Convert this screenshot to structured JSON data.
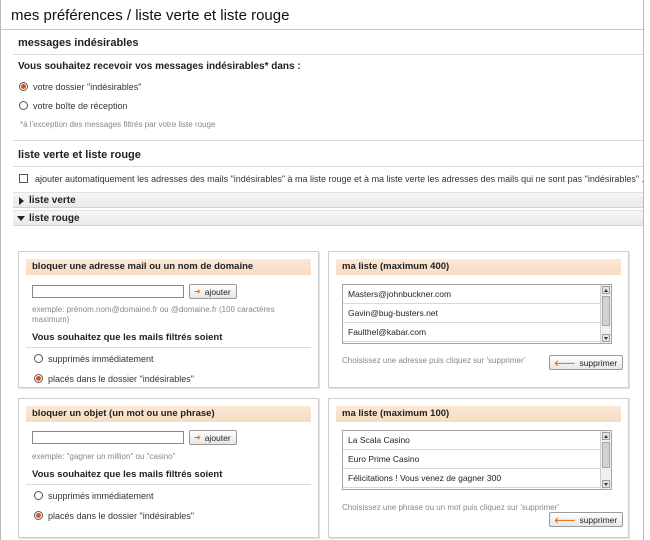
{
  "page": {
    "title": "mes préférences / liste verte et liste rouge"
  },
  "spam": {
    "heading": "messages indésirables",
    "question": "Vous souhaitez recevoir vos messages indésirables* dans :",
    "options": [
      "votre dossier \"indésirables\"",
      "votre boîte de réception"
    ],
    "selected": 0,
    "footnote": "*à l'exception des messages filtrés par votre liste rouge"
  },
  "lists": {
    "heading": "liste verte et liste rouge",
    "auto_add_label": "ajouter automatiquement les adresses des mails \"indésirables\" à ma liste rouge et à ma liste verte les adresses des mails qui ne sont pas \"indésirables\" .",
    "auto_add_checked": false,
    "green_label": "liste verte",
    "red_label": "liste rouge"
  },
  "block_address": {
    "title": "bloquer une adresse mail ou un nom de domaine",
    "input_value": "",
    "button": "ajouter",
    "example": "exemple: prénom.nom@domaine.fr ou @domaine.fr (100 caractères maximum)",
    "filter_question": "Vous souhaitez que les mails filtrés soient",
    "options": [
      "supprimés immédiatement",
      "placés dans le dossier \"indésirables\""
    ],
    "selected": 1
  },
  "address_list": {
    "title": "ma liste (maximum 400)",
    "items": [
      "Masters@johnbuckner.com",
      "Gavin@bug-busters.net",
      "Faulthel@kabar.com"
    ],
    "hint": "Choisissez une adresse puis cliquez sur 'supprimer'",
    "button": "supprimer"
  },
  "block_phrase": {
    "title": "bloquer un objet (un mot ou une phrase)",
    "input_value": "",
    "button": "ajouter",
    "example": "exemple: \"gagner un million\" ou \"casino\"",
    "filter_question": "Vous souhaitez que les mails filtrés soient",
    "options": [
      "supprimés immédiatement",
      "placés dans le dossier \"indésirables\""
    ],
    "selected": 1
  },
  "phrase_list": {
    "title": "ma liste (maximum 100)",
    "items": [
      "La Scala Casino",
      "Euro Prime Casino",
      "Félicitations ! Vous venez de gagner 300"
    ],
    "hint": "Choisissez une phrase ou un mot puis cliquez sur 'supprimer'",
    "button": "supprimer"
  },
  "colors": {
    "accent": "#d9531e",
    "panel_header": "#f8dfc8"
  }
}
